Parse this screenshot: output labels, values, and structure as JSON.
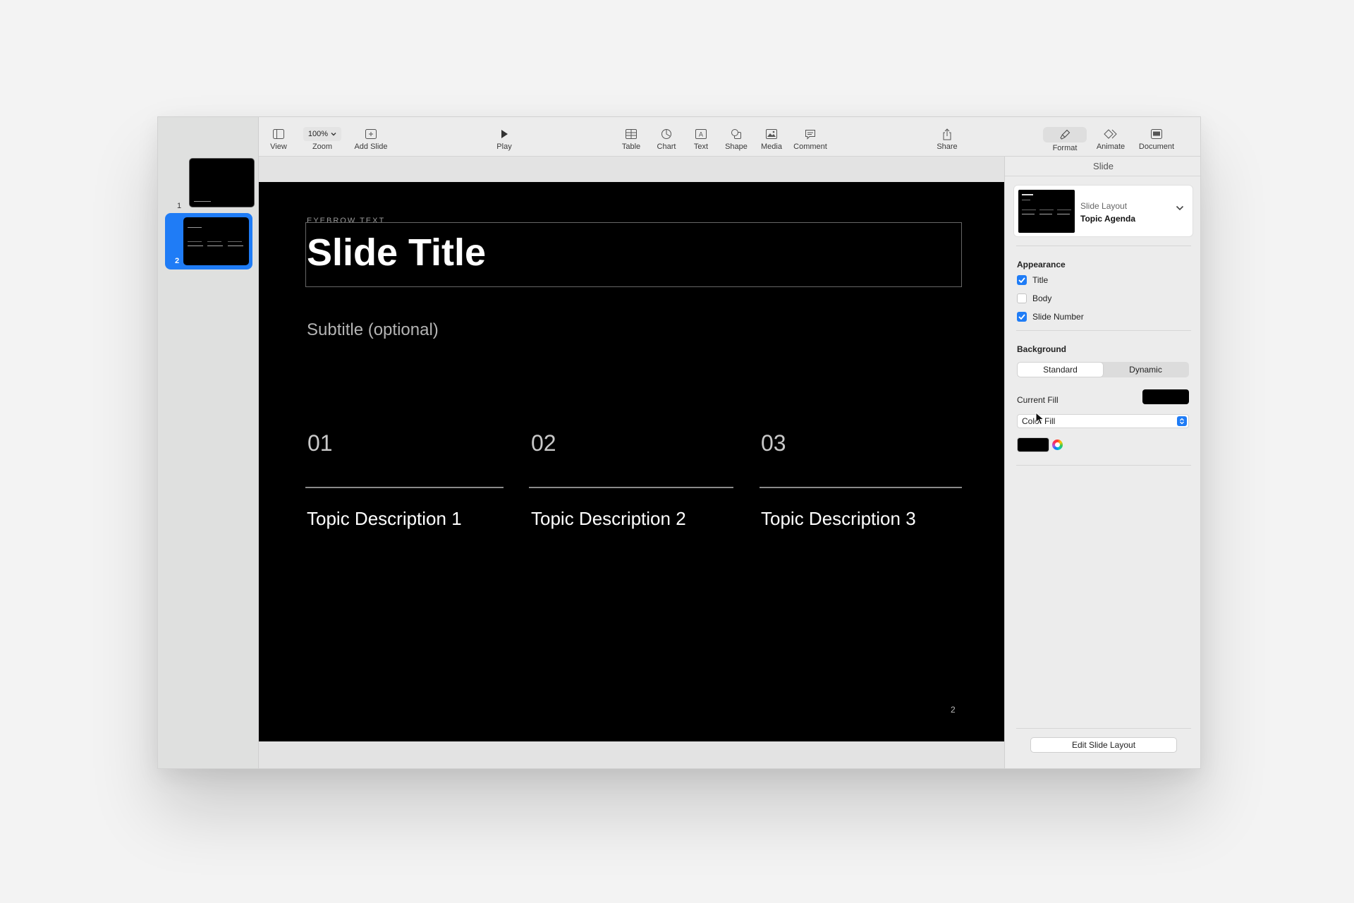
{
  "navigator": {
    "slides": [
      {
        "number": "1",
        "selected": false
      },
      {
        "number": "2",
        "selected": true
      }
    ]
  },
  "toolbar": {
    "view_label": "View",
    "zoom_value": "100%",
    "zoom_label": "Zoom",
    "add_slide_label": "Add Slide",
    "play_label": "Play",
    "table_label": "Table",
    "chart_label": "Chart",
    "text_label": "Text",
    "shape_label": "Shape",
    "media_label": "Media",
    "comment_label": "Comment",
    "share_label": "Share",
    "format_label": "Format",
    "animate_label": "Animate",
    "document_label": "Document"
  },
  "slide": {
    "eyebrow": "EYEBROW TEXT",
    "title": "Slide Title",
    "subtitle": "Subtitle (optional)",
    "topics": [
      {
        "number": "01",
        "description": "Topic Description 1"
      },
      {
        "number": "02",
        "description": "Topic Description 2"
      },
      {
        "number": "03",
        "description": "Topic Description 3"
      }
    ],
    "slide_number": "2",
    "background_color": "#000000"
  },
  "inspector": {
    "tab": "Slide",
    "layout_caption": "Slide Layout",
    "layout_name": "Topic Agenda",
    "appearance_label": "Appearance",
    "appearance": [
      {
        "label": "Title",
        "checked": true
      },
      {
        "label": "Body",
        "checked": false
      },
      {
        "label": "Slide Number",
        "checked": true
      }
    ],
    "background_label": "Background",
    "background_modes": [
      "Standard",
      "Dynamic"
    ],
    "background_mode_selected": "Standard",
    "current_fill_label": "Current Fill",
    "fill_type": "Color Fill",
    "fill_color": "#000000",
    "edit_layout_label": "Edit Slide Layout"
  },
  "colors": {
    "accent": "#1f7cf6"
  }
}
